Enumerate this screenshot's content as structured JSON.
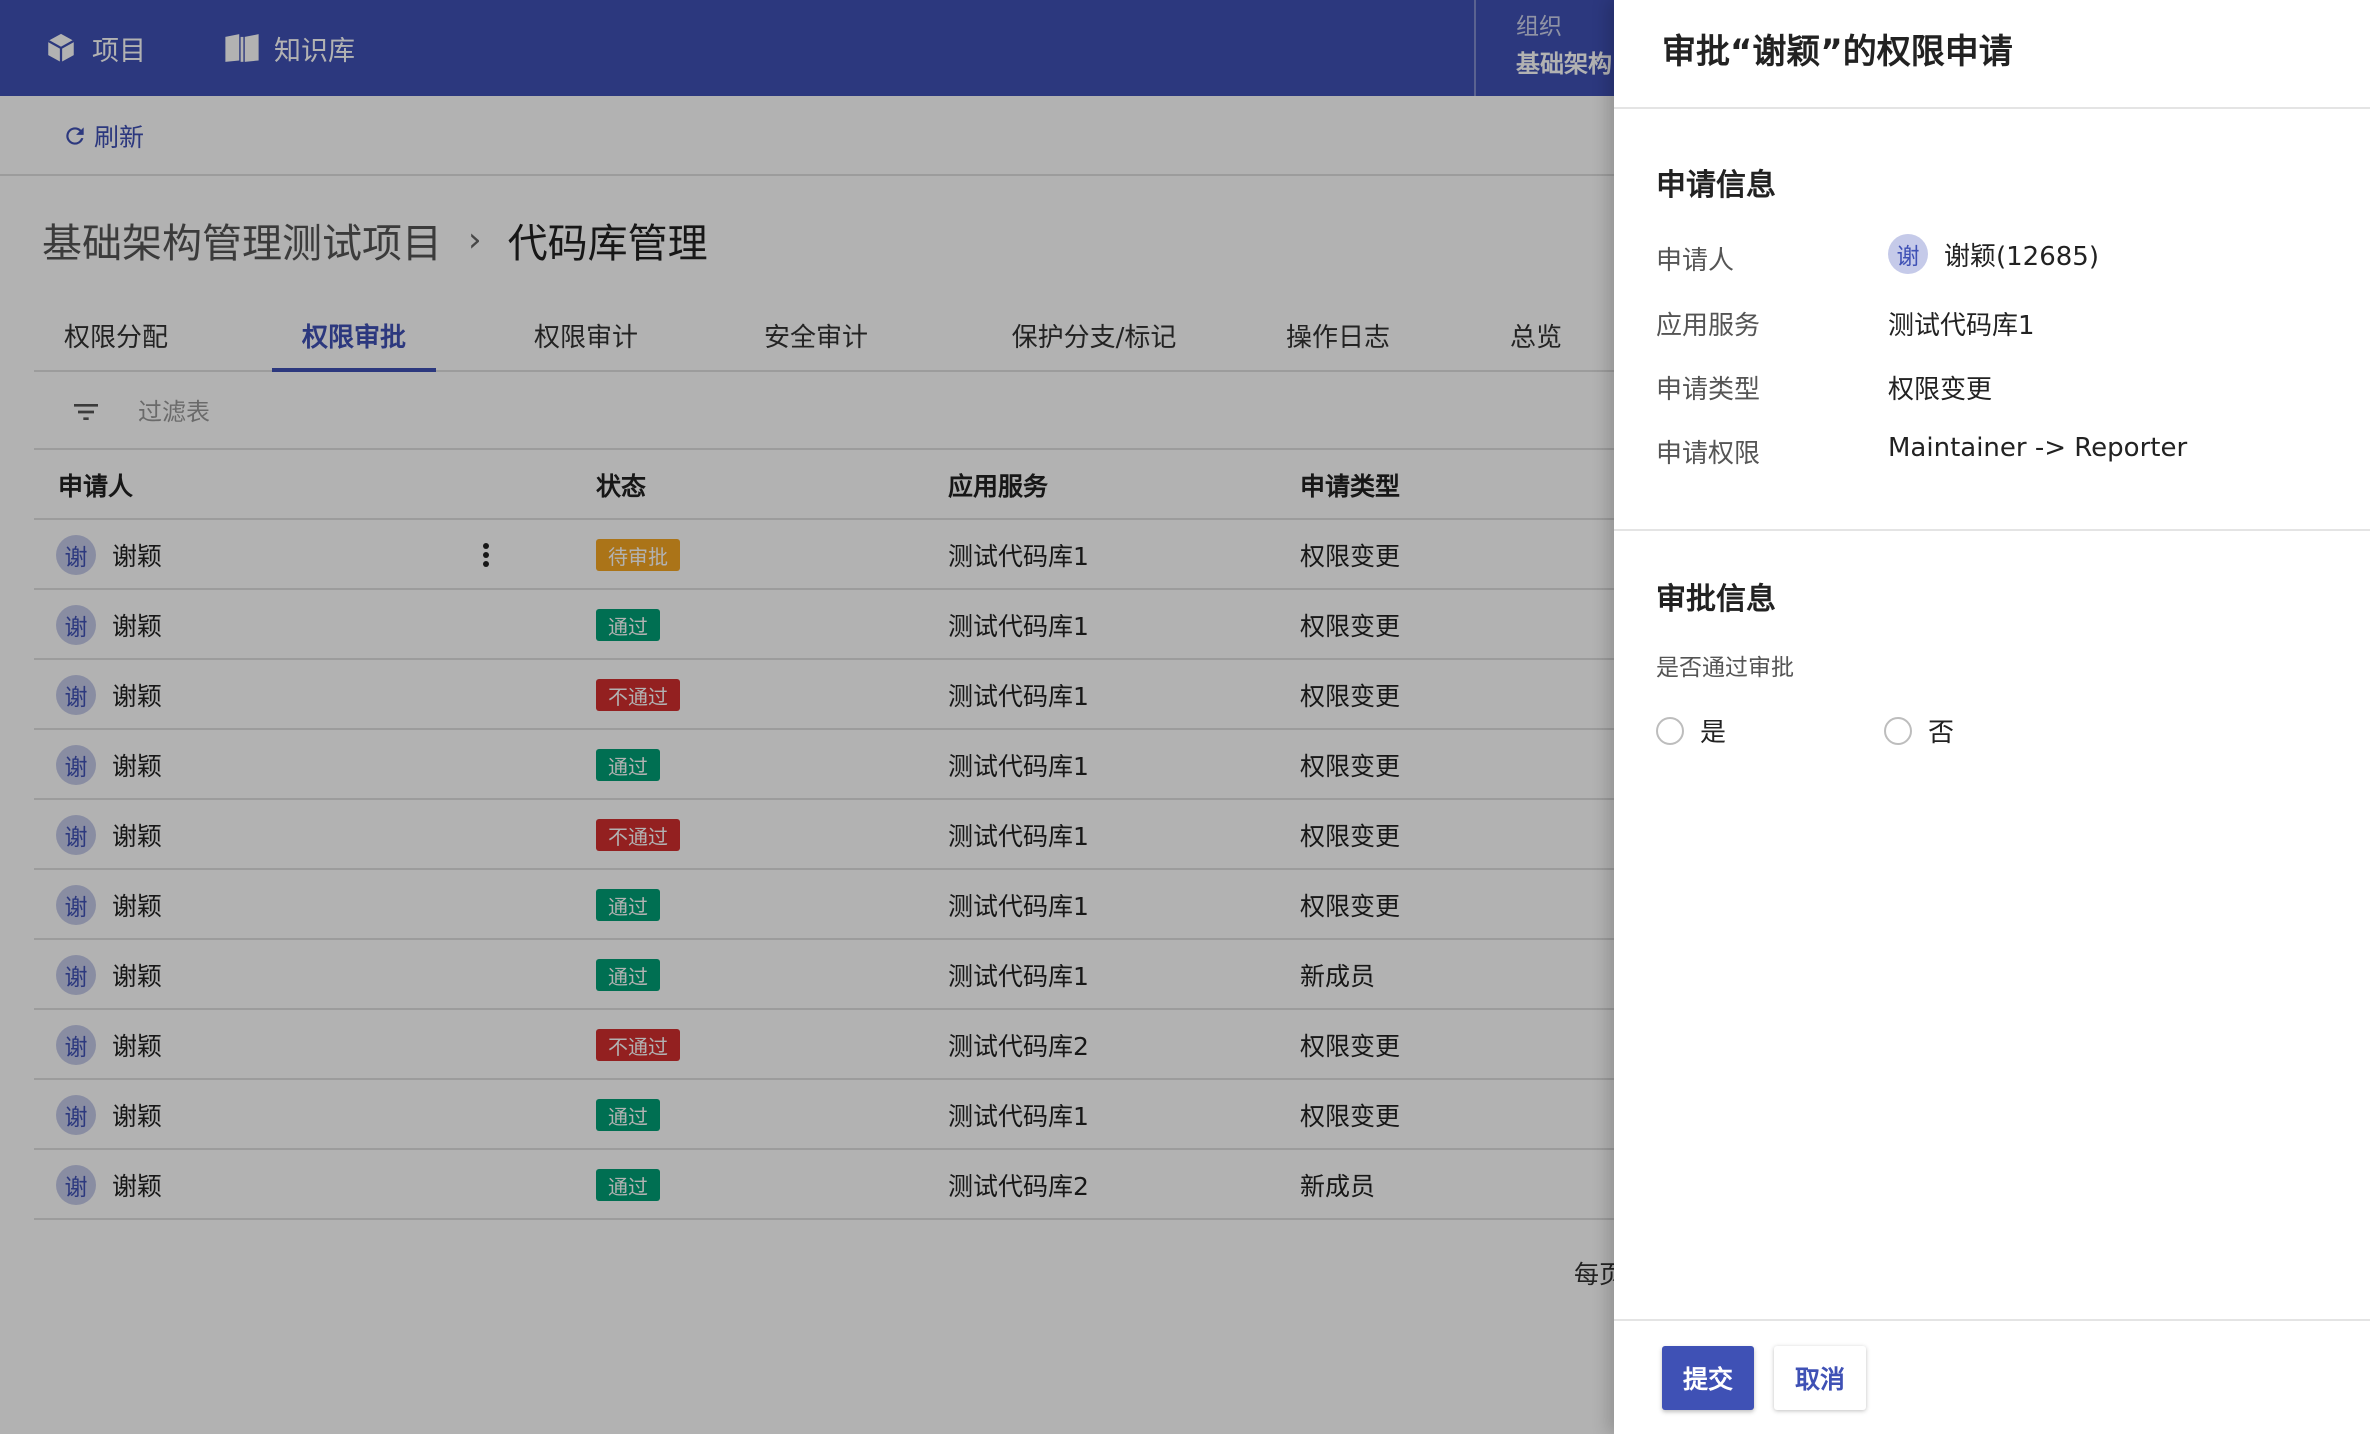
{
  "topnav": {
    "projects_label": "项目",
    "kb_label": "知识库",
    "org_caption": "组织",
    "org_name": "基础架构"
  },
  "toolbar": {
    "refresh_label": "刷新"
  },
  "breadcrumb": {
    "project": "基础架构管理测试项目",
    "separator": "›",
    "current": "代码库管理"
  },
  "tabs": [
    {
      "label": "权限分配"
    },
    {
      "label": "权限审批",
      "active": true
    },
    {
      "label": "权限审计"
    },
    {
      "label": "安全审计"
    },
    {
      "label": "保护分支/标记"
    },
    {
      "label": "操作日志"
    },
    {
      "label": "总览"
    }
  ],
  "filter": {
    "placeholder": "过滤表"
  },
  "table": {
    "headers": {
      "applicant": "申请人",
      "status": "状态",
      "service": "应用服务",
      "type": "申请类型"
    },
    "rows": [
      {
        "avatar": "谢",
        "name": "谢颖",
        "status": "待审批",
        "service": "测试代码库1",
        "type": "权限变更"
      },
      {
        "avatar": "谢",
        "name": "谢颖",
        "status": "通过",
        "service": "测试代码库1",
        "type": "权限变更"
      },
      {
        "avatar": "谢",
        "name": "谢颖",
        "status": "不通过",
        "service": "测试代码库1",
        "type": "权限变更"
      },
      {
        "avatar": "谢",
        "name": "谢颖",
        "status": "通过",
        "service": "测试代码库1",
        "type": "权限变更"
      },
      {
        "avatar": "谢",
        "name": "谢颖",
        "status": "不通过",
        "service": "测试代码库1",
        "type": "权限变更"
      },
      {
        "avatar": "谢",
        "name": "谢颖",
        "status": "通过",
        "service": "测试代码库1",
        "type": "权限变更"
      },
      {
        "avatar": "谢",
        "name": "谢颖",
        "status": "通过",
        "service": "测试代码库1",
        "type": "新成员"
      },
      {
        "avatar": "谢",
        "name": "谢颖",
        "status": "不通过",
        "service": "测试代码库2",
        "type": "权限变更"
      },
      {
        "avatar": "谢",
        "name": "谢颖",
        "status": "通过",
        "service": "测试代码库1",
        "type": "权限变更"
      },
      {
        "avatar": "谢",
        "name": "谢颖",
        "status": "通过",
        "service": "测试代码库2",
        "type": "新成员"
      }
    ],
    "footer_text": "每页"
  },
  "status_colors": {
    "待审批": "#f5a623",
    "通过": "#00a076",
    "不通过": "#d32f2f"
  },
  "colors": {
    "primary": "#3f51b5",
    "avatar_bg": "#c5cae9"
  },
  "drawer": {
    "title": "审批“谢颖”的权限申请",
    "apply_section_title": "申请信息",
    "fields": [
      {
        "label": "申请人",
        "value": "谢颖(12685)",
        "avatar": "谢"
      },
      {
        "label": "应用服务",
        "value": "测试代码库1"
      },
      {
        "label": "申请类型",
        "value": "权限变更"
      },
      {
        "label": "申请权限",
        "value": "Maintainer -> Reporter"
      }
    ],
    "approval_section_title": "审批信息",
    "question": "是否通过审批",
    "options": {
      "yes": "是",
      "no": "否"
    },
    "submit_label": "提交",
    "cancel_label": "取消"
  }
}
